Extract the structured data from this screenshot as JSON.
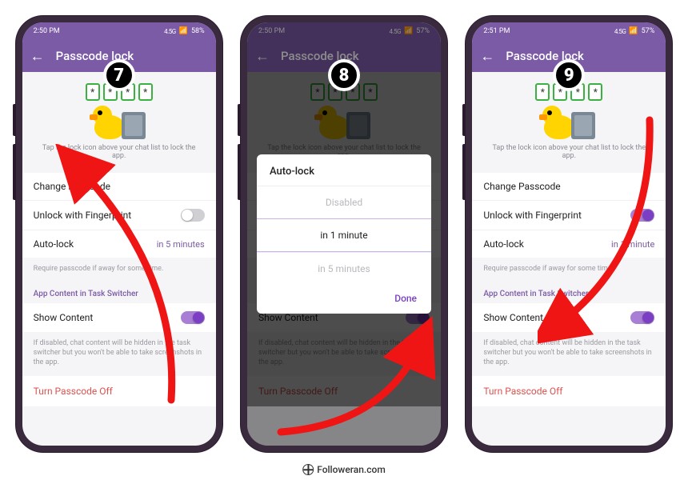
{
  "watermark": "Followeran.com",
  "badges": [
    "7",
    "8",
    "9"
  ],
  "statusbar": {
    "times": [
      "2:50 PM",
      "2:50 PM",
      "2:51 PM"
    ],
    "battery": [
      "58%",
      "57%",
      "57%"
    ],
    "signal_text": "4.5G"
  },
  "appbar": {
    "title": "Passcode lock",
    "back_glyph": "←"
  },
  "hero": {
    "mask": "*",
    "hint": "Tap the lock icon above your chat list to lock the app."
  },
  "rows": {
    "change": "Change Passcode",
    "fingerprint": "Unlock with Fingerprint",
    "autolock": "Auto-lock",
    "autolock_sub": "Require passcode if away for some time.",
    "section": "App Content in Task Switcher",
    "show_content": "Show Content",
    "show_sub": "If disabled, chat content will be hidden in the task switcher but you won't be able to take screenshots in the app.",
    "turn_off": "Turn Passcode Off"
  },
  "screens": {
    "s7": {
      "autolock_value": "in 5 minutes",
      "fingerprint_on": false,
      "show_content_on": true
    },
    "s9": {
      "autolock_value": "in 1 minute",
      "fingerprint_on": true,
      "show_content_on": true
    }
  },
  "dialog": {
    "title": "Auto-lock",
    "options": [
      "Disabled",
      "in 1 minute",
      "in 5 minutes"
    ],
    "selected_index": 1,
    "done": "Done"
  }
}
